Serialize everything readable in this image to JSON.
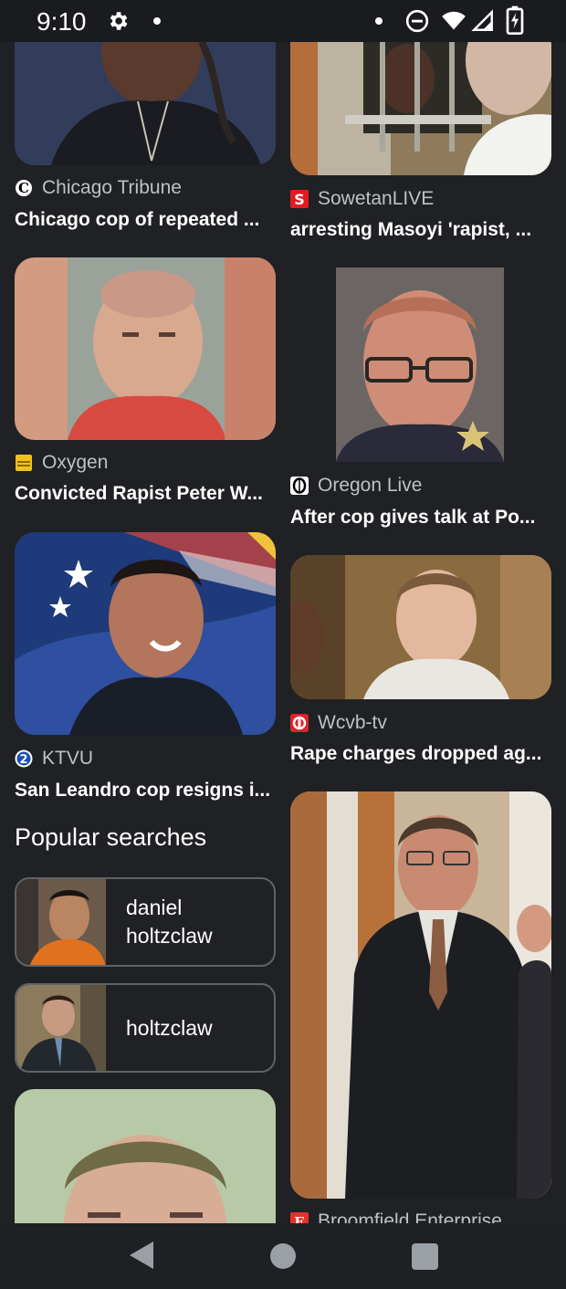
{
  "status_bar": {
    "time": "9:10",
    "icons": [
      "gear-icon",
      "notification-dot-icon",
      "dnd-icon",
      "wifi-icon",
      "cell-signal-icon",
      "battery-charging-icon"
    ]
  },
  "left_column": [
    {
      "source": "Chicago Tribune",
      "title": "Chicago cop of repeated ...",
      "source_icon": "chicago-tribune-logo-icon"
    },
    {
      "source": "Oxygen",
      "title": "Convicted Rapist Peter W...",
      "source_icon": "oxygen-logo-icon"
    },
    {
      "source": "KTVU",
      "title": "San Leandro cop resigns i...",
      "source_icon": "ktvu-logo-icon"
    }
  ],
  "right_column": [
    {
      "source": "SowetanLIVE",
      "title": "arresting Masoyi 'rapist, ...",
      "source_icon": "sowetan-logo-icon"
    },
    {
      "source": "Oregon Live",
      "title": "After cop gives talk at Po...",
      "source_icon": "oregon-live-logo-icon"
    },
    {
      "source": "Wcvb-tv",
      "title": "Rape charges dropped ag...",
      "source_icon": "wcvb-logo-icon"
    },
    {
      "source": "Broomfield Enterprise",
      "title": "",
      "source_icon": "broomfield-logo-icon"
    }
  ],
  "popular_searches": {
    "heading": "Popular searches",
    "items": [
      {
        "label": "daniel holtzclaw"
      },
      {
        "label": "holtzclaw"
      }
    ]
  },
  "nav_bar": {
    "icons": [
      "back-icon",
      "home-icon",
      "recents-icon"
    ]
  }
}
